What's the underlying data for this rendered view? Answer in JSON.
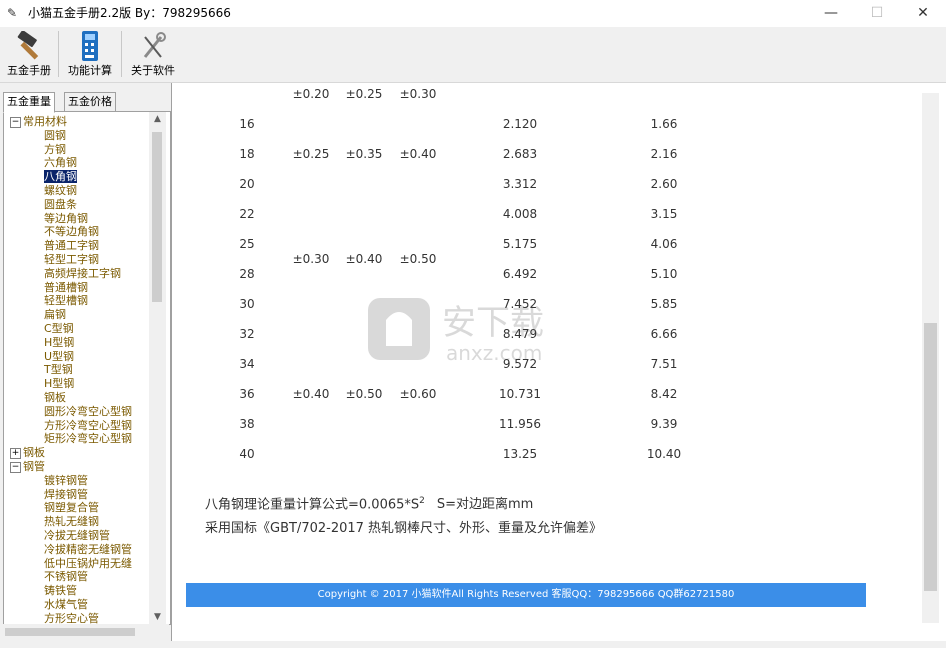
{
  "window": {
    "title": "小猫五金手册2.2版 By：798295666",
    "minimize_glyph": "—",
    "maximize_glyph": "☐",
    "close_glyph": "✕"
  },
  "toolbar": {
    "items": [
      {
        "label": "五金手册",
        "icon": "hammer-icon"
      },
      {
        "label": "功能计算",
        "icon": "calculator-icon"
      },
      {
        "label": "关于软件",
        "icon": "tools-icon"
      }
    ]
  },
  "sidebar": {
    "tabs": [
      {
        "label": "五金重量",
        "active": true
      },
      {
        "label": "五金价格",
        "active": false
      }
    ],
    "tree": [
      {
        "text": "常用材料",
        "level": 0,
        "expander": "−"
      },
      {
        "text": "圆钢",
        "level": 1
      },
      {
        "text": "方钢",
        "level": 1
      },
      {
        "text": "六角钢",
        "level": 1
      },
      {
        "text": "八角钢",
        "level": 1,
        "selected": true
      },
      {
        "text": "螺纹钢",
        "level": 1
      },
      {
        "text": "圆盘条",
        "level": 1
      },
      {
        "text": "等边角钢",
        "level": 1
      },
      {
        "text": "不等边角钢",
        "level": 1
      },
      {
        "text": "普通工字钢",
        "level": 1
      },
      {
        "text": "轻型工字钢",
        "level": 1
      },
      {
        "text": "高频焊接工字钢",
        "level": 1
      },
      {
        "text": "普通槽钢",
        "level": 1
      },
      {
        "text": "轻型槽钢",
        "level": 1
      },
      {
        "text": "扁钢",
        "level": 1
      },
      {
        "text": "C型钢",
        "level": 1
      },
      {
        "text": "H型钢",
        "level": 1
      },
      {
        "text": "U型钢",
        "level": 1
      },
      {
        "text": "T型钢",
        "level": 1
      },
      {
        "text": "H型钢",
        "level": 1
      },
      {
        "text": "钢板",
        "level": 1
      },
      {
        "text": "圆形冷弯空心型钢",
        "level": 1
      },
      {
        "text": "方形冷弯空心型钢",
        "level": 1
      },
      {
        "text": "矩形冷弯空心型钢",
        "level": 1
      },
      {
        "text": "钢板",
        "level": 0,
        "expander": "+"
      },
      {
        "text": "钢管",
        "level": 0,
        "expander": "−"
      },
      {
        "text": "镀锌钢管",
        "level": 1
      },
      {
        "text": "焊接钢管",
        "level": 1
      },
      {
        "text": "钢塑复合管",
        "level": 1
      },
      {
        "text": "热轧无缝钢",
        "level": 1
      },
      {
        "text": "冷拔无缝钢管",
        "level": 1
      },
      {
        "text": "冷拔精密无缝钢管",
        "level": 1
      },
      {
        "text": "低中压锅炉用无缝",
        "level": 1
      },
      {
        "text": "不锈钢管",
        "level": 1
      },
      {
        "text": "铸铁管",
        "level": 1
      },
      {
        "text": "水煤气管",
        "level": 1
      },
      {
        "text": "方形空心管",
        "level": 1
      }
    ]
  },
  "table": {
    "partial_row": [
      "±0.20",
      "±0.25",
      "±0.30"
    ],
    "rows": [
      {
        "size": "16",
        "weight": "2.120",
        "mass": "1.66"
      },
      {
        "size": "18",
        "weight": "2.683",
        "mass": "2.16"
      },
      {
        "size": "20",
        "weight": "3.312",
        "mass": "2.60"
      },
      {
        "size": "22",
        "weight": "4.008",
        "mass": "3.15"
      },
      {
        "size": "25",
        "weight": "5.175",
        "mass": "4.06"
      },
      {
        "size": "28",
        "weight": "6.492",
        "mass": "5.10"
      },
      {
        "size": "30",
        "weight": "7.452",
        "mass": "5.85"
      },
      {
        "size": "32",
        "weight": "8.479",
        "mass": "6.66"
      },
      {
        "size": "34",
        "weight": "9.572",
        "mass": "7.51"
      },
      {
        "size": "36",
        "weight": "10.731",
        "mass": "8.42"
      },
      {
        "size": "38",
        "weight": "11.956",
        "mass": "9.39"
      },
      {
        "size": "40",
        "weight": "13.25",
        "mass": "10.40"
      }
    ],
    "tolerance_groups": [
      {
        "a": "±0.25",
        "b": "±0.35",
        "c": "±0.40"
      },
      {
        "a": "±0.30",
        "b": "±0.40",
        "c": "±0.50"
      },
      {
        "a": "±0.40",
        "b": "±0.50",
        "c": "±0.60"
      }
    ]
  },
  "formula": {
    "text": "八角钢理论重量计算公式=0.0065*S",
    "exponent": "2",
    "note": "S=对边距离mm"
  },
  "standard": "采用国标《GBT/702-2017 热轧钢棒尺寸、外形、重量及允许偏差》",
  "footer": "Copyright © 2017 小猫软件All Rights Reserved  客服QQ：798295666 QQ群62721580",
  "watermark": {
    "cn": "安下载",
    "en": "anxz.com"
  }
}
